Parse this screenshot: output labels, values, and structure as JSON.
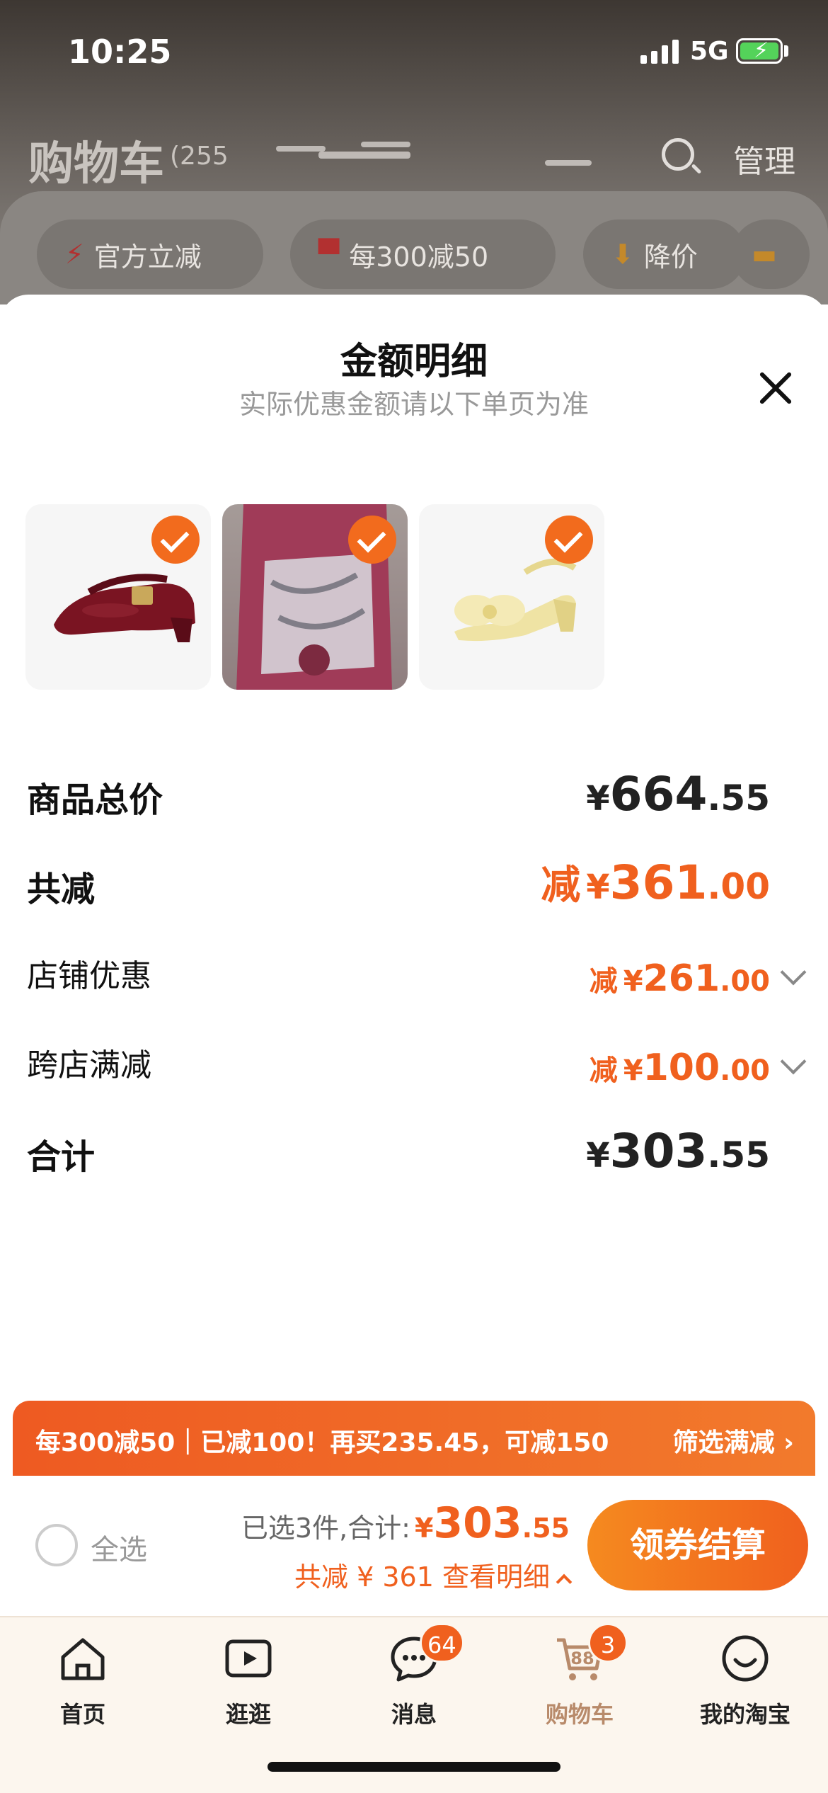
{
  "status_bar": {
    "time": "10:25",
    "network": "5G"
  },
  "background": {
    "cart_title": "购物车",
    "cart_count": "(255",
    "manage_label": "管理",
    "chips": [
      {
        "icon": "lightning-icon",
        "label": "官方立减"
      },
      {
        "icon": "shop-icon",
        "label": "每300减50"
      },
      {
        "icon": "down-arrow-icon",
        "label": "降价"
      }
    ]
  },
  "sheet": {
    "title": "金额明细",
    "subtitle": "实际优惠金额请以下单页为准",
    "products": [
      {
        "name": "burgundy-mary-jane-shoe",
        "selected": true
      },
      {
        "name": "pink-rain-poncho",
        "selected": true
      },
      {
        "name": "cream-bow-sandal",
        "selected": true
      }
    ],
    "rows": {
      "subtotal": {
        "label": "商品总价",
        "currency": "¥",
        "int": "664",
        "dec": ".55"
      },
      "discount_total": {
        "label": "共减",
        "prefix": "减",
        "currency": "¥",
        "int": "361",
        "dec": ".00"
      },
      "shop_discount": {
        "label": "店铺优惠",
        "prefix": "减",
        "currency": "¥",
        "int": "261",
        "dec": ".00"
      },
      "cross_shop": {
        "label": "跨店满减",
        "prefix": "减",
        "currency": "¥",
        "int": "100",
        "dec": ".00"
      },
      "total": {
        "label": "合计",
        "currency": "¥",
        "int": "303",
        "dec": ".55"
      }
    }
  },
  "promo_bar": {
    "text": "每300减50｜已减100！再买235.45，可减150",
    "filter_label": "筛选满减 ›"
  },
  "checkout": {
    "select_all_label": "全选",
    "selected_text": "已选3件,合计:",
    "currency": "¥",
    "total_int": "303",
    "total_dec": ".55",
    "discount_text": "共减 ¥ 361  查看明细",
    "button_label": "领券结算"
  },
  "tabbar": {
    "tabs": [
      {
        "label": "首页",
        "icon": "home-icon"
      },
      {
        "label": "逛逛",
        "icon": "video-play-icon"
      },
      {
        "label": "消息",
        "icon": "chat-bubble-icon",
        "badge": "64"
      },
      {
        "label": "购物车",
        "icon": "cart-icon",
        "badge": "3",
        "active": true,
        "icon_text": "88"
      },
      {
        "label": "我的淘宝",
        "icon": "smile-face-icon"
      }
    ]
  },
  "colors": {
    "accent": "#f0601e",
    "tab_active": "#b88a6a",
    "tabbar_bg": "#fcf6ee"
  }
}
